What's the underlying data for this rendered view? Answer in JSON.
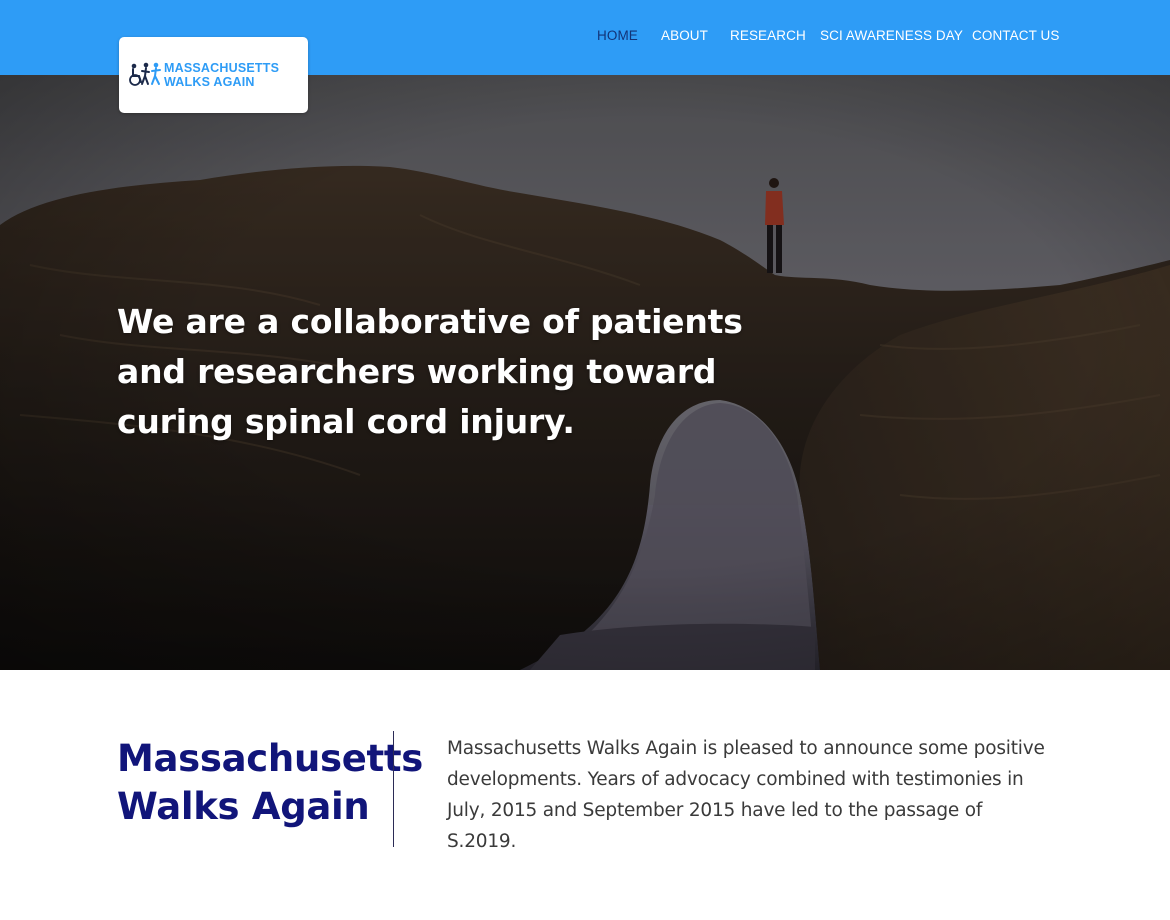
{
  "nav": {
    "items": [
      {
        "label": "HOME",
        "active": true
      },
      {
        "label": "ABOUT",
        "active": false
      },
      {
        "label": "RESEARCH",
        "active": false
      },
      {
        "label": "SCI AWARENESS DAY",
        "active": false
      },
      {
        "label": "CONTACT US",
        "active": false
      }
    ]
  },
  "logo": {
    "line1": "MASSACHUSETTS",
    "line2": "WALKS AGAIN",
    "icon": "wheelchair-walking-figures-icon"
  },
  "hero": {
    "headline": "We are a collaborative of patients and researchers working toward curing spinal cord injury.",
    "image": "sea-arch-rock-with-person-photo"
  },
  "intro": {
    "title": "Massachusetts Walks Again",
    "body": "Massachusetts Walks Again is pleased to announce some positive developments. Years of advocacy combined with testimonies in July, 2015 and September 2015 have led to the passage of S.2019."
  },
  "colors": {
    "brand_blue": "#2e9cf6",
    "nav_active": "#123478",
    "title_navy": "#11157a",
    "body_text": "#3a3a3a"
  }
}
